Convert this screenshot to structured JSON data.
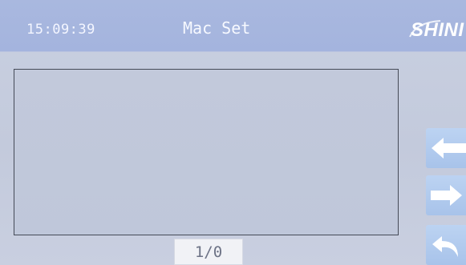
{
  "header": {
    "clock": "15:09:39",
    "title": "Mac Set",
    "logo_text": "SHINI"
  },
  "buttons": [
    {
      "icon": "arrow-left-icon",
      "action": "previous"
    },
    {
      "icon": "arrow-right-icon",
      "action": "next"
    },
    {
      "icon": "return-icon",
      "action": "return"
    }
  ],
  "pager": {
    "indicator": "1/0"
  },
  "colors": {
    "header": "#a4b4de",
    "background": "#c3cadc",
    "panel_border": "#454a57",
    "side_button": "#a8c3ea",
    "text_light": "#f4f6ff"
  }
}
